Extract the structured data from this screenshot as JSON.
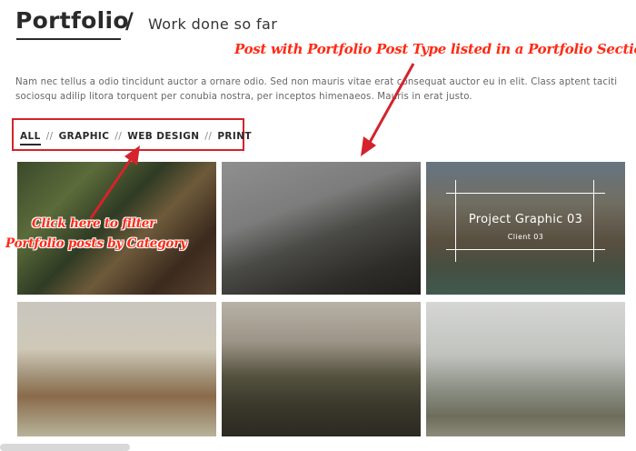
{
  "header": {
    "title": "Portfolio",
    "separator": "/",
    "subtitle": "Work done so far"
  },
  "intro_text": "Nam nec tellus a odio tincidunt auctor a ornare odio. Sed non mauris vitae erat consequat auctor eu in elit. Class aptent taciti sociosqu adilip litora torquent per conubia nostra, per inceptos himenaeos. Mauris in erat justo.",
  "filters": {
    "items": [
      "ALL",
      "GRAPHIC",
      "WEB DESIGN",
      "PRINT"
    ],
    "separator": "//",
    "active": "ALL"
  },
  "portfolio": {
    "hover_item": {
      "title": "Project Graphic 03",
      "client": "Client 03"
    }
  },
  "annotations": {
    "top": "Post with Portfolio Post Type listed in a Portfolio Section",
    "filter_line1": "Click here to filter",
    "filter_line2": "Portfolio posts by Category"
  },
  "colors": {
    "annotation": "#ff2a14",
    "highlight_box": "#d4232b",
    "text": "#2a2a2a"
  }
}
